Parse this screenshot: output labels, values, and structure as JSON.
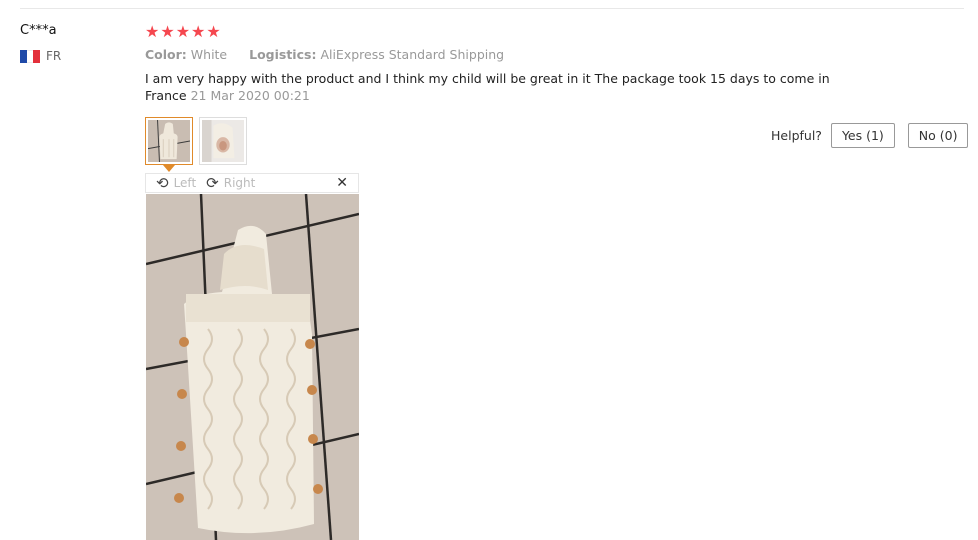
{
  "reviewer": {
    "name": "C***a",
    "country_code": "FR",
    "flag_colors": [
      "#1f4aa8",
      "#ffffff",
      "#e3303b"
    ]
  },
  "review": {
    "rating": 5,
    "max_rating": 5,
    "star_color": "#f5474f",
    "attributes": [
      {
        "label": "Color:",
        "value": "White"
      },
      {
        "label": "Logistics:",
        "value": "AliExpress Standard Shipping"
      }
    ],
    "text": "I am very happy with the product and I think my child will be great in it The package took 15 days to come in France",
    "date": "21 Mar 2020 00:21"
  },
  "photos": {
    "thumbnails": [
      {
        "name": "photo-thumbnail-1",
        "active": true
      },
      {
        "name": "photo-thumbnail-2",
        "active": false
      }
    ],
    "viewer": {
      "rotate_left_label": "Left",
      "rotate_right_label": "Right",
      "rotate_left_icon": "rotate-left-icon",
      "rotate_right_icon": "rotate-right-icon",
      "close_icon": "close-icon"
    },
    "accent_color": "#e08a2a"
  },
  "helpful": {
    "label": "Helpful?",
    "yes_label": "Yes (1)",
    "no_label": "No (0)"
  }
}
